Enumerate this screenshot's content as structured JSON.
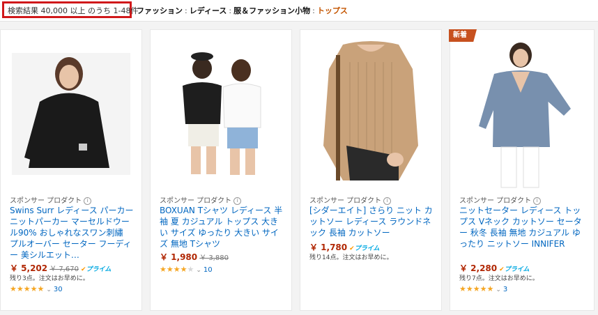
{
  "header": {
    "results_text": "検索結果 40,000 以上 のうち 1-48件",
    "breadcrumb": [
      "ファッション",
      "レディース",
      "服＆ファッション小物",
      "トップス"
    ]
  },
  "products": [
    {
      "sponsor": "スポンサー プロダクト",
      "title": "Swins Surr レディース パーカー ニットパーカー マーセルドウール90% おしゃれなスワン刺繡 プルオーバー セーター フーディー 美シルエット…",
      "price": "￥ 5,202",
      "old_price": "￥ 7,670",
      "prime": "プライム",
      "stock": "残り3点。注文はお早めに。",
      "stars": 5,
      "review_count": "30"
    },
    {
      "sponsor": "スポンサー プロダクト",
      "title": "BOXUAN Tシャツ レディース 半袖 夏 カジュアル トップス 大きい サイズ ゆったり 大きい サイズ 無地 Tシャツ",
      "price": "￥ 1,980",
      "old_price": "￥ 3,880",
      "prime": "",
      "stock": "",
      "stars": 4,
      "review_count": "10"
    },
    {
      "sponsor": "スポンサー プロダクト",
      "title": "[シダーエイト] さらり ニット カットソー レディース ラウンドネック 長袖 カットソー",
      "price": "￥ 1,780",
      "old_price": "",
      "prime": "プライム",
      "stock": "残り14点。注文はお早めに。",
      "stars": 0,
      "review_count": ""
    },
    {
      "badge": "新着",
      "sponsor": "スポンサー プロダクト",
      "title": "ニットセーター レディース トップス Vネック カットソー セーター 秋冬 長袖 無地 カジュアル ゆったり ニットソー INNIFER",
      "price": "￥ 2,280",
      "old_price": "",
      "prime": "プライム",
      "stock": "残り7点。注文はお早めに。",
      "stars": 5,
      "review_count": "3"
    }
  ],
  "colors": {
    "highlight_box": "#d0181a",
    "link": "#0066c0",
    "price": "#b12704",
    "star": "#f5a623",
    "badge": "#c7511f"
  }
}
